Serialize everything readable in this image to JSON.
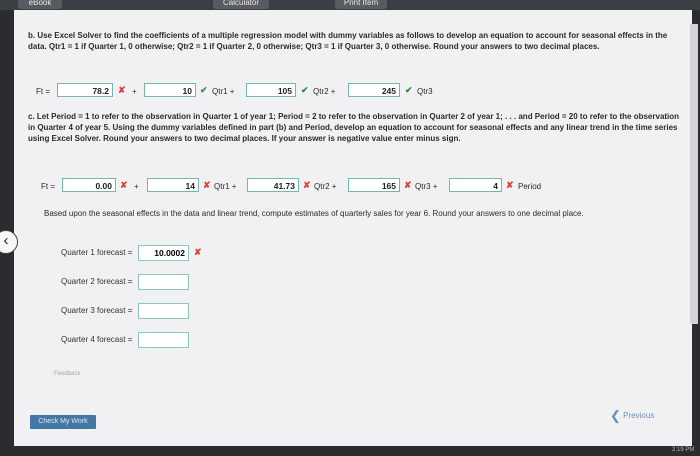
{
  "tabs": {
    "ebook": "eBook",
    "calculator": "Calculator",
    "print": "Print Item"
  },
  "partB": {
    "text": "b. Use Excel Solver to find the coefficients of a multiple regression model with dummy variables as follows to develop an equation to account for seasonal effects in the data. Qtr1 = 1 if Quarter 1, 0 otherwise; Qtr2 = 1 if Quarter 2, 0 otherwise; Qtr3 = 1 if Quarter 3, 0 otherwise. Round your answers to two decimal places.",
    "ft": "Ft =",
    "b0": "78.2",
    "b1": "10",
    "b2": "105",
    "b3": "245",
    "plus": "+",
    "qtr1": "Qtr1 +",
    "qtr2": "Qtr2 +",
    "qtr3": "Qtr3"
  },
  "partC": {
    "text": "c. Let Period = 1 to refer to the observation in Quarter 1 of year 1; Period = 2 to refer to the observation in Quarter 2 of year 1; . . . and Period = 20 to refer to the observation in Quarter 4 of year 5. Using the dummy variables defined in part (b) and Period, develop an equation to account for seasonal effects and any linear trend in the time series using Excel Solver. Round your answers to two decimal places. If your answer is negative value enter minus sign.",
    "ft": "Ft =",
    "b0": "0.00",
    "b1": "14",
    "b2": "41.73",
    "b3": "165",
    "b4": "4",
    "plus": "+",
    "qtr1": "Qtr1 +",
    "qtr2": "Qtr2 +",
    "qtr3": "Qtr3 +",
    "period": "Period"
  },
  "forecast": {
    "text": "Based upon the seasonal effects in the data and linear trend, compute estimates of quarterly sales for year 6. Round your answers to one decimal place.",
    "q1_label": "Quarter 1 forecast =",
    "q1_value": "10.0002",
    "q2_label": "Quarter 2 forecast =",
    "q2_value": "",
    "q3_label": "Quarter 3 forecast =",
    "q3_value": "",
    "q4_label": "Quarter 4 forecast =",
    "q4_value": ""
  },
  "feedback": "Feedback",
  "check_button": "Check My Work",
  "previous": "Previous",
  "clock": "2:19 PM",
  "marks": {
    "check": "✔",
    "cross": "✘"
  },
  "colors": {
    "correct": "#2f8f3a",
    "incorrect": "#d4463e",
    "accent": "#4577a5",
    "field_border": "#74b7ac"
  }
}
